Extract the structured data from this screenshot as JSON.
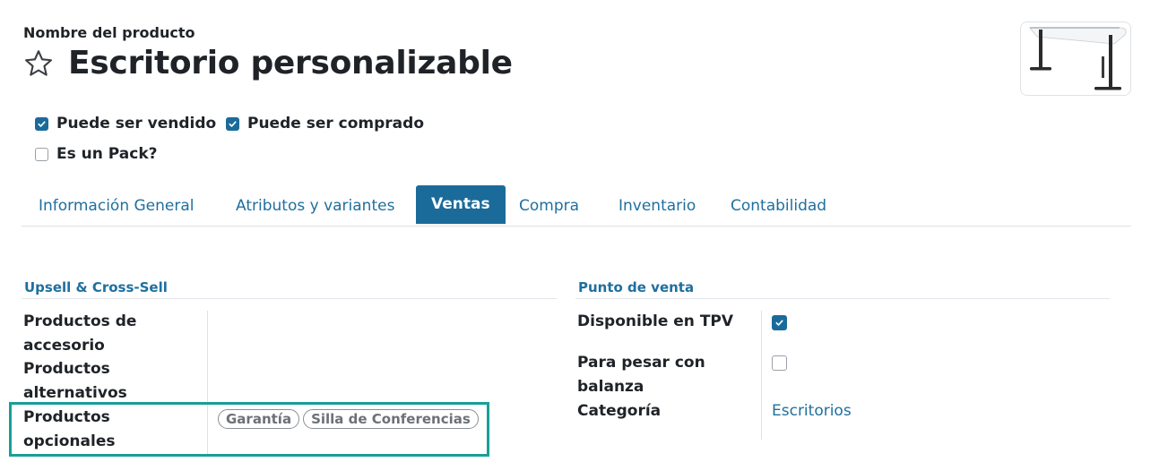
{
  "header": {
    "field_label": "Nombre del producto",
    "title": "Escritorio personalizable",
    "star_icon": "star-outline-icon"
  },
  "checkboxes": {
    "can_be_sold": {
      "label": "Puede ser vendido",
      "checked": true
    },
    "can_be_purchased": {
      "label": "Puede ser comprado",
      "checked": true
    },
    "is_pack": {
      "label": "Es un Pack?",
      "checked": false
    }
  },
  "tabs": [
    {
      "label": "Información General",
      "active": false
    },
    {
      "label": "Atributos y variantes",
      "active": false
    },
    {
      "label": "Ventas",
      "active": true
    },
    {
      "label": "Compra",
      "active": false
    },
    {
      "label": "Inventario",
      "active": false
    },
    {
      "label": "Contabilidad",
      "active": false
    }
  ],
  "upsell": {
    "section_title": "Upsell & Cross-Sell",
    "accessory_label_1": "Productos de",
    "accessory_label_2": "accesorio",
    "alternative_label_1": "Productos",
    "alternative_label_2": "alternativos",
    "optional_label_1": "Productos",
    "optional_label_2": "opcionales",
    "optional_tags": [
      "Garantía",
      "Silla de Conferencias"
    ]
  },
  "pos": {
    "section_title": "Punto de venta",
    "available_label": "Disponible en TPV",
    "available_checked": true,
    "scale_label_1": "Para pesar con",
    "scale_label_2": "balanza",
    "scale_checked": false,
    "category_label": "Categoría",
    "category_value": "Escritorios"
  },
  "colors": {
    "accent": "#1b6b9a",
    "link": "#1f6f9f",
    "highlight": "#17a096"
  }
}
